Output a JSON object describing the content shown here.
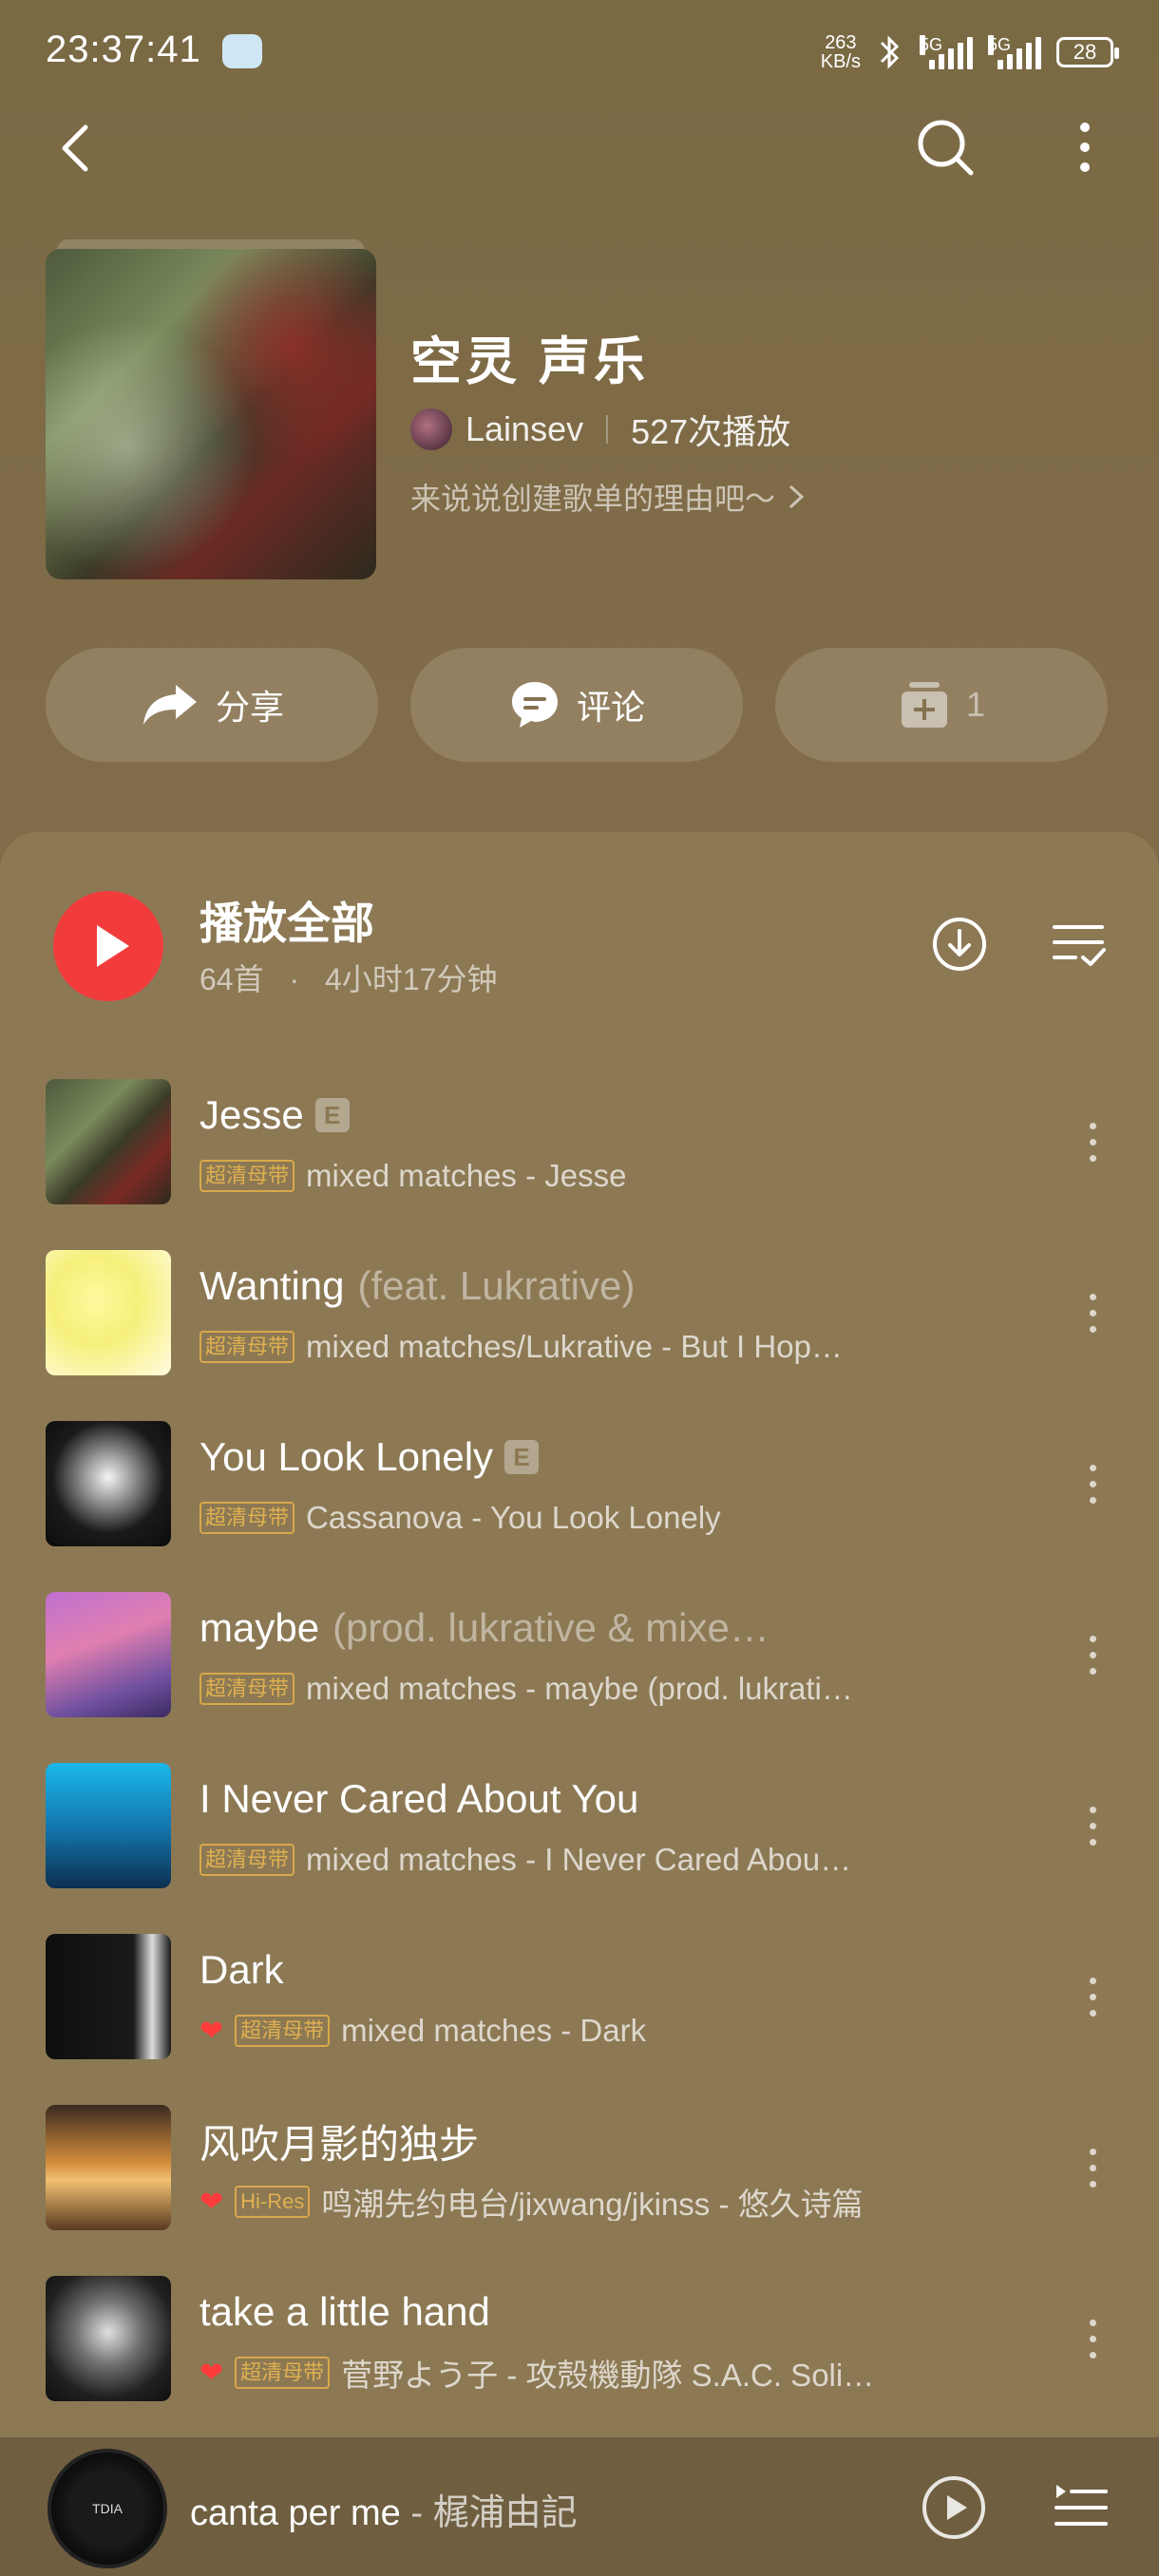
{
  "status_bar": {
    "time": "23:37:41",
    "net_speed_value": "263",
    "net_speed_unit": "KB/s",
    "sig1_label": "5G",
    "sig2_label": "5G",
    "battery": "28"
  },
  "playlist": {
    "title": "空灵 声乐",
    "creator": "Lainsev",
    "play_count": "527次播放",
    "description": "来说说创建歌单的理由吧～"
  },
  "actions": {
    "share_label": "分享",
    "comment_label": "评论",
    "collect_count": "1"
  },
  "list_header": {
    "play_all_label": "播放全部",
    "song_count": "64首",
    "separator": "·",
    "duration": "4小时17分钟"
  },
  "songs": [
    {
      "title": "Jesse",
      "feat": "",
      "explicit": "E",
      "liked": false,
      "tag": "超清母带",
      "subtitle": "mixed matches - Jesse"
    },
    {
      "title": "Wanting",
      "feat": "(feat. Lukrative)",
      "explicit": "",
      "liked": false,
      "tag": "超清母带",
      "subtitle": "mixed matches/Lukrative - But I Hop…"
    },
    {
      "title": "You Look Lonely",
      "feat": "",
      "explicit": "E",
      "liked": false,
      "tag": "超清母带",
      "subtitle": "Cassanova - You Look Lonely"
    },
    {
      "title": "maybe",
      "feat": "(prod. lukrative & mixe…",
      "explicit": "",
      "liked": false,
      "tag": "超清母带",
      "subtitle": "mixed matches - maybe (prod. lukrati…"
    },
    {
      "title": "I Never Cared About You",
      "feat": "",
      "explicit": "",
      "liked": false,
      "tag": "超清母带",
      "subtitle": "mixed matches - I Never Cared Abou…"
    },
    {
      "title": "Dark",
      "feat": "",
      "explicit": "",
      "liked": true,
      "tag": "超清母带",
      "subtitle": "mixed matches - Dark"
    },
    {
      "title": "风吹月影的独步",
      "feat": "",
      "explicit": "",
      "liked": true,
      "tag": "Hi-Res",
      "subtitle": "鸣潮先约电台/jixwang/jkinss - 悠久诗篇"
    },
    {
      "title": "take a little hand",
      "feat": "",
      "explicit": "",
      "liked": true,
      "tag": "超清母带",
      "subtitle": "菅野よう子 - 攻殻機動隊 S.A.C. Soli…"
    }
  ],
  "mini_player": {
    "disc_label": "TDIA",
    "title": "canta per me",
    "separator": " - ",
    "artist": "梶浦由記"
  },
  "colors": {
    "accent_red": "#f23c3c",
    "tag_gold": "#e0b050",
    "background": "#7d6a46"
  },
  "icons": [
    "back-icon",
    "search-icon",
    "more-vertical-icon",
    "share-arrow-icon",
    "comment-bubble-icon",
    "add-to-collection-icon",
    "play-icon",
    "download-icon",
    "multi-select-icon",
    "heart-icon",
    "queue-icon"
  ]
}
